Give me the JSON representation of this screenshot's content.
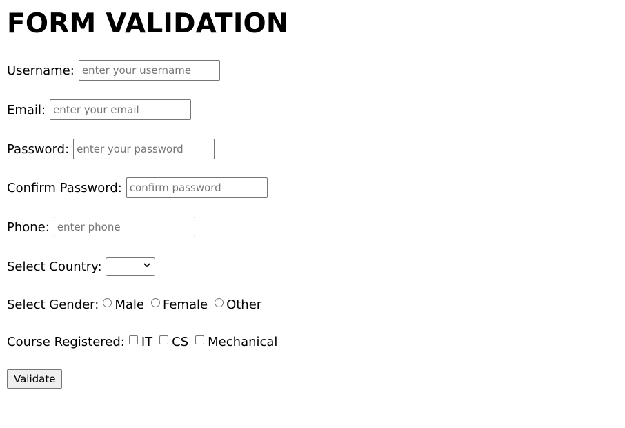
{
  "title": "FORM VALIDATION",
  "fields": {
    "username": {
      "label": "Username:",
      "placeholder": "enter your username",
      "value": ""
    },
    "email": {
      "label": "Email:",
      "placeholder": "enter your email",
      "value": ""
    },
    "password": {
      "label": "Password:",
      "placeholder": "enter your password",
      "value": ""
    },
    "confirm_password": {
      "label": "Confirm Password:",
      "placeholder": "confirm password",
      "value": ""
    },
    "phone": {
      "label": "Phone:",
      "placeholder": "enter phone",
      "value": ""
    }
  },
  "country": {
    "label": "Select Country:",
    "selected": ""
  },
  "gender": {
    "label": "Select Gender:",
    "options": [
      "Male",
      "Female",
      "Other"
    ]
  },
  "courses": {
    "label": "Course Registered:",
    "options": [
      "IT",
      "CS",
      "Mechanical"
    ]
  },
  "submit_label": "Validate",
  "icons": {
    "select_arrow": "chevron-down-icon",
    "radio": "radio-button-icon",
    "checkbox": "checkbox-icon"
  }
}
